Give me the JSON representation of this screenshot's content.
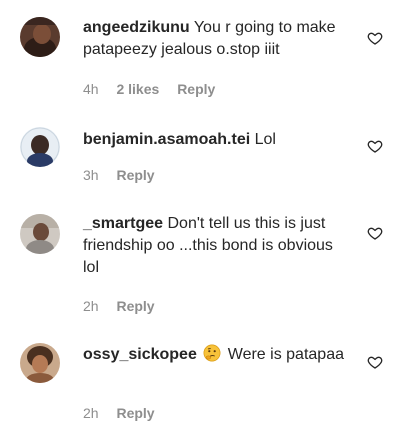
{
  "comments": [
    {
      "username": "angeedzikunu",
      "text": "You r going to make patapeezy jealous o.stop iiit",
      "time": "4h",
      "likes": "2 likes",
      "reply": "Reply",
      "avatar_icon": "avatar-photo"
    },
    {
      "username": "benjamin.asamoah.tei",
      "text": "Lol",
      "time": "3h",
      "likes": "",
      "reply": "Reply",
      "avatar_icon": "avatar-photo"
    },
    {
      "username": "_smartgee",
      "text": "Don't tell us this is just friendship oo ...this bond is obvious lol",
      "time": "2h",
      "likes": "",
      "reply": "Reply",
      "avatar_icon": "avatar-photo"
    },
    {
      "username": "ossy_sickopee",
      "emoji": "thinking-face-emoji",
      "text": "Were is patapaa",
      "time": "2h",
      "likes": "",
      "reply": "Reply",
      "avatar_icon": "avatar-photo"
    }
  ],
  "icons": {
    "like": "heart-outline-icon"
  },
  "colors": {
    "text": "#262626",
    "meta": "#8e8e8e",
    "background": "#ffffff"
  }
}
